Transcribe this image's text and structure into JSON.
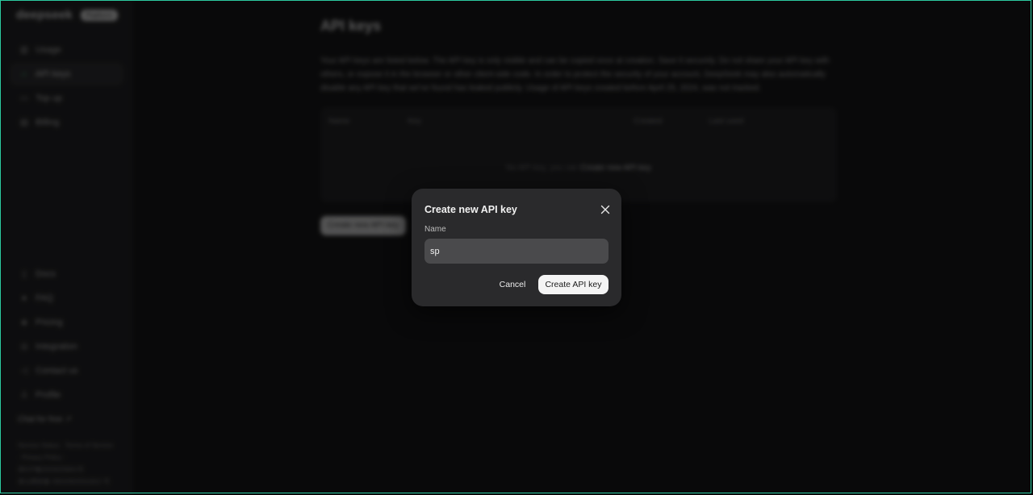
{
  "sidebar": {
    "logo": "deepseek",
    "badge": "Platform",
    "nav": [
      {
        "label": "Usage",
        "icon": "bar-chart-icon"
      },
      {
        "label": "API keys",
        "icon": "search-icon"
      },
      {
        "label": "Top up",
        "icon": "card-icon"
      },
      {
        "label": "Billing",
        "icon": "bill-icon"
      }
    ],
    "bottom_nav": [
      {
        "label": "Docs",
        "icon": "doc-icon"
      },
      {
        "label": "FAQ",
        "icon": "help-icon"
      },
      {
        "label": "Pricing",
        "icon": "tag-icon"
      },
      {
        "label": "Integration",
        "icon": "puzzle-icon"
      },
      {
        "label": "Contact us",
        "icon": "mail-icon"
      },
      {
        "label": "Profile",
        "icon": "user-icon"
      }
    ],
    "chat_free": "Chat for free ↗",
    "footer": [
      "Service Status · Terms of Service",
      "· Privacy Policy ·",
      "浙ICP备2023025841号",
      "浙公网安备 33010502011812 号"
    ]
  },
  "main": {
    "title": "API keys",
    "description": "Your API keys are listed below. The API key is only visible and can be copied once at creation. Save it securely. Do not share your API key with others, or expose it in the browser or other client-side code. In order to protect the security of your account, DeepSeek may also automatically disable any API key that we've found has leaked publicly. Usage of API keys created before April 25, 2024, was not tracked.",
    "table": {
      "columns": [
        "Name",
        "Key",
        "Created",
        "Last used"
      ],
      "empty_text": "No API key, you can",
      "empty_link": "Create new API key"
    },
    "create_button": "Create new API key"
  },
  "modal": {
    "title": "Create new API key",
    "name_label": "Name",
    "name_value": "sp",
    "cancel": "Cancel",
    "confirm": "Create API key"
  }
}
